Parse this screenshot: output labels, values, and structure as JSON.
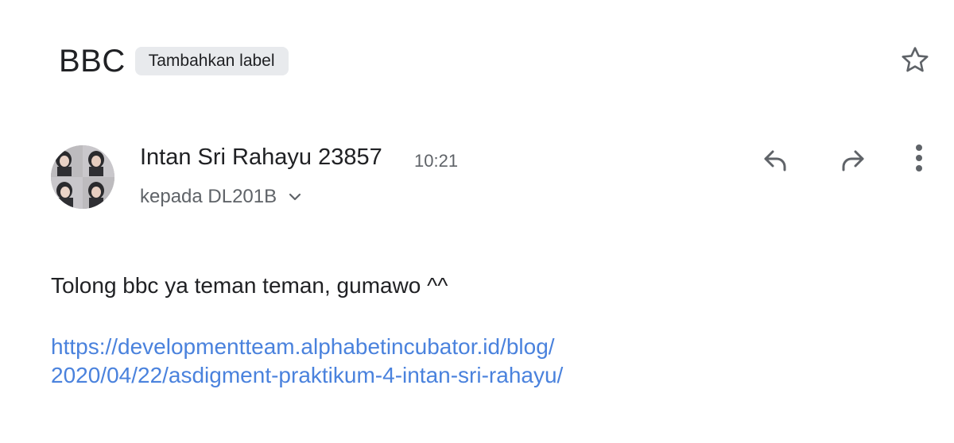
{
  "email": {
    "subject": "BBC",
    "label_chip": "Tambahkan label",
    "star_icon": "star-outline-icon",
    "sender": {
      "name": "Intan Sri Rahayu 23857",
      "time": "10:21",
      "recipient_line": "kepada DL201B",
      "avatar_icon": "avatar-photo"
    },
    "actions": {
      "reply_icon": "reply-icon",
      "forward_icon": "forward-icon",
      "more_icon": "more-vert-icon"
    },
    "body": {
      "text": "Tolong bbc ya teman teman, gumawo ^^",
      "link_line1": "https://developmentteam.alphabetincubator.id/blog/",
      "link_line2": "2020/04/22/asdigment-praktikum-4-intan-sri-rahayu/"
    }
  },
  "colors": {
    "text_primary": "#202124",
    "text_secondary": "#5f6368",
    "chip_bg": "#e8eaed",
    "link": "#4a82dd"
  }
}
